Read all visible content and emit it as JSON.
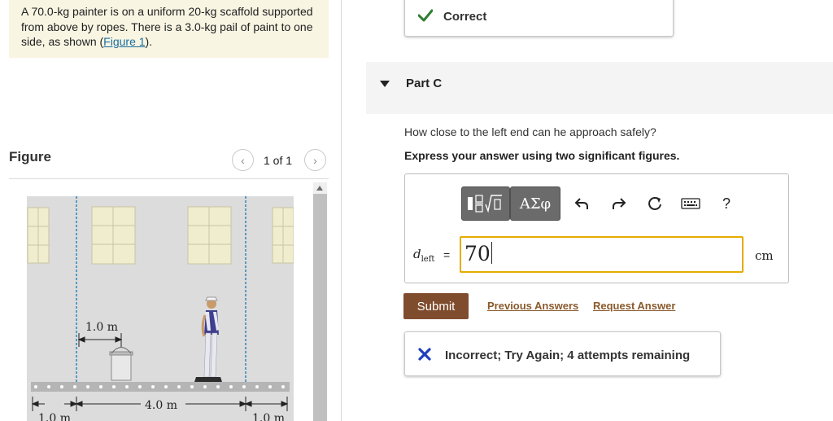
{
  "problem": {
    "text_before": "A 70.0-kg painter is on a uniform 20-kg scaffold supported from above by ropes. There is a 3.0-kg pail of paint to one side, as shown (",
    "figure_link": "Figure 1",
    "text_after": ")."
  },
  "figure_panel": {
    "title": "Figure",
    "pager": "1 of 1",
    "labels": {
      "pail_offset": "1.0 m",
      "span": "4.0 m",
      "left_overhang": "1.0 m",
      "right_overhang": "1.0 m"
    }
  },
  "previous_part": {
    "status": "Correct"
  },
  "part": {
    "label": "Part C",
    "question": "How close to the left end can he approach safely?",
    "instruction": "Express your answer using two significant figures.",
    "toolbar": {
      "symbols_label": "ΑΣφ",
      "help_label": "?"
    },
    "variable": "d",
    "variable_sub": "left",
    "equals": "=",
    "answer_value": "70",
    "unit": "cm",
    "submit_label": "Submit",
    "previous_answers_label": "Previous Answers",
    "request_answer_label": "Request Answer",
    "feedback": "Incorrect; Try Again; 4 attempts remaining"
  },
  "colors": {
    "problem_bg": "#f8f5e3",
    "correct_check": "#2e7d32",
    "incorrect_x": "#1f3fbf",
    "submit_bg": "#7f4c2d",
    "input_focus": "#e6ac00"
  }
}
